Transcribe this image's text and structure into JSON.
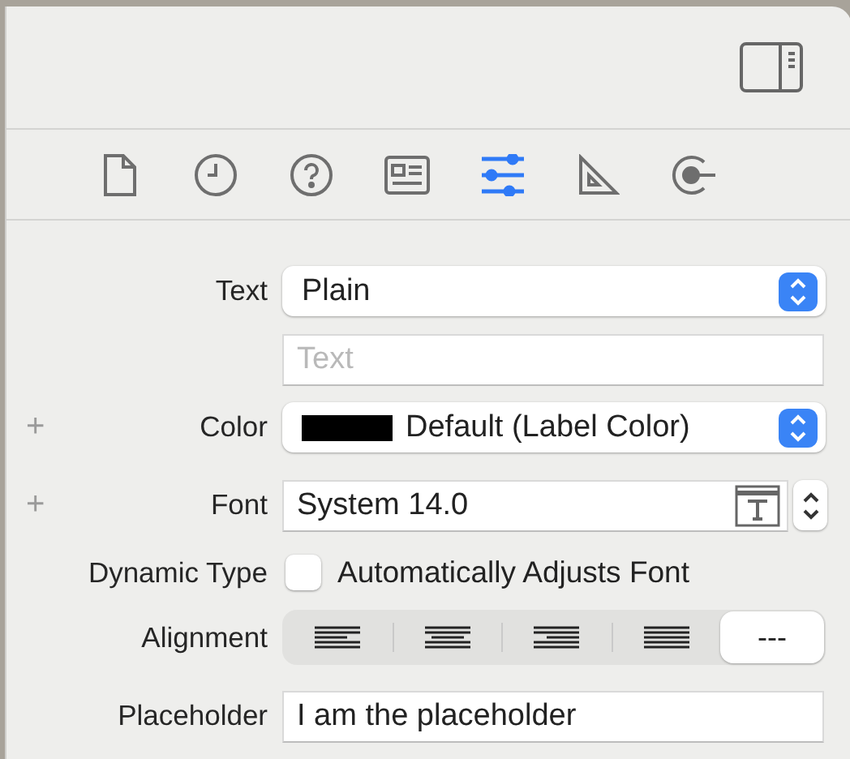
{
  "tabs": [
    {
      "kind": "file",
      "selected": false
    },
    {
      "kind": "history",
      "selected": false
    },
    {
      "kind": "help",
      "selected": false
    },
    {
      "kind": "identity",
      "selected": false
    },
    {
      "kind": "attributes",
      "selected": true
    },
    {
      "kind": "size",
      "selected": false
    },
    {
      "kind": "connections",
      "selected": false
    }
  ],
  "rows": [
    {
      "kind": "popup",
      "label": "Text",
      "value": "Plain"
    },
    {
      "kind": "field",
      "placeholder": "Text"
    },
    {
      "kind": "color",
      "plus": "+",
      "label": "Color",
      "color": "#000000",
      "value": "Default (Label Color)"
    },
    {
      "kind": "font",
      "plus": "+",
      "label": "Font",
      "value": "System 14.0"
    },
    {
      "kind": "checkbox",
      "label": "Dynamic Type",
      "text": "Automatically Adjusts Font",
      "checked": false
    },
    {
      "kind": "segmented",
      "label": "Alignment",
      "segments": [
        {
          "kind": "left",
          "selected": false
        },
        {
          "kind": "center",
          "selected": false
        },
        {
          "kind": "right",
          "selected": false
        },
        {
          "kind": "justify",
          "selected": false
        },
        {
          "kind": "text",
          "label": "---",
          "selected": true
        }
      ]
    },
    {
      "kind": "field",
      "label": "Placeholder",
      "value": "I am the placeholder"
    }
  ]
}
